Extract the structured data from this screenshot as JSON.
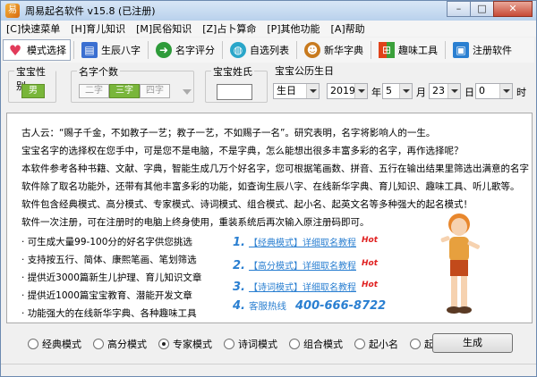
{
  "window": {
    "title": "周易起名软件 v15.8 (已注册)"
  },
  "menu": [
    "[C]快速菜单",
    "[H]育儿知识",
    "[M]民俗知识",
    "[Z]占卜算命",
    "[P]其他功能",
    "[A]帮助"
  ],
  "toolbar": [
    {
      "label": "模式选择",
      "icon": "heart-icon",
      "color": "#e23b5a"
    },
    {
      "label": "生辰八字",
      "icon": "book-icon",
      "color": "#3a6fd1"
    },
    {
      "label": "名字评分",
      "icon": "arrow-right-icon",
      "color": "#2e9b3a"
    },
    {
      "label": "自选列表",
      "icon": "globe-icon",
      "color": "#2aa6c9"
    },
    {
      "label": "新华字典",
      "icon": "person-icon",
      "color": "#c87a1e"
    },
    {
      "label": "趣味工具",
      "icon": "windows-icon",
      "color": "#e07b1a"
    },
    {
      "label": "注册软件",
      "icon": "register-icon",
      "color": "#2a7fd1"
    }
  ],
  "options": {
    "gender": {
      "label": "宝宝性别",
      "value": "男"
    },
    "char_count": {
      "label": "名字个数",
      "items": [
        "二字",
        "三字",
        "四字"
      ],
      "selected": "三字"
    },
    "surname": {
      "label": "宝宝姓氏",
      "value": ""
    },
    "birthday": {
      "label": "宝宝公历生日",
      "type": "生日",
      "year": "2019",
      "year_unit": "年",
      "month": "5",
      "month_unit": "月",
      "day": "23",
      "day_unit": "日",
      "hour": "0",
      "hour_unit": "时"
    }
  },
  "content": {
    "lines": [
      "古人云：“赐子千金，不如教子一艺；教子一艺，不如赐子一名”。研究表明，名字将影响人的一生。",
      "宝宝名字的选择权在您手中，可是您不是电脑，不是字典，怎么能想出很多丰富多彩的名字，再作选择呢？",
      "本软件参考各种书籍、文献、字典，智能生成几万个好名字，您可根据笔画数、拼音、五行在输出结果里筛选出满意的名字",
      "软件除了取名功能外，还带有其他丰富多彩的功能，如查询生辰八字、在线新华字典、育儿知识、趣味工具、听儿歌等。",
      "软件包含经典模式、高分模式、专家模式、诗词模式、组合模式、起小名、起英文名等多种强大的起名模式！",
      "软件一次注册，可在注册时的电脑上终身使用，重装系统后再次输入原注册码即可。"
    ],
    "bullets": [
      "可生成大量99-100分的好名字供您挑选",
      "支持按五行、简体、康熙笔画、笔划筛选",
      "提供近3000篇新生儿护理、育儿知识文章",
      "提供近1000篇宝宝教育、潜能开发文章",
      "功能强大的在线新华字典、各种趣味工具"
    ],
    "links": [
      {
        "num": "1.",
        "text": "【经典模式】详细取名教程",
        "hot": "Hot"
      },
      {
        "num": "2.",
        "text": "【高分模式】详细取名教程",
        "hot": "Hot"
      },
      {
        "num": "3.",
        "text": "【诗词模式】详细取名教程",
        "hot": "Hot"
      }
    ],
    "hotline": {
      "num": "4.",
      "label": "客服热线",
      "number": "400-666-8722"
    }
  },
  "modes": {
    "items": [
      "经典模式",
      "高分模式",
      "专家模式",
      "诗词模式",
      "组合模式",
      "起小名",
      "起英文名"
    ],
    "selected": "专家模式"
  },
  "generate_label": "生成"
}
